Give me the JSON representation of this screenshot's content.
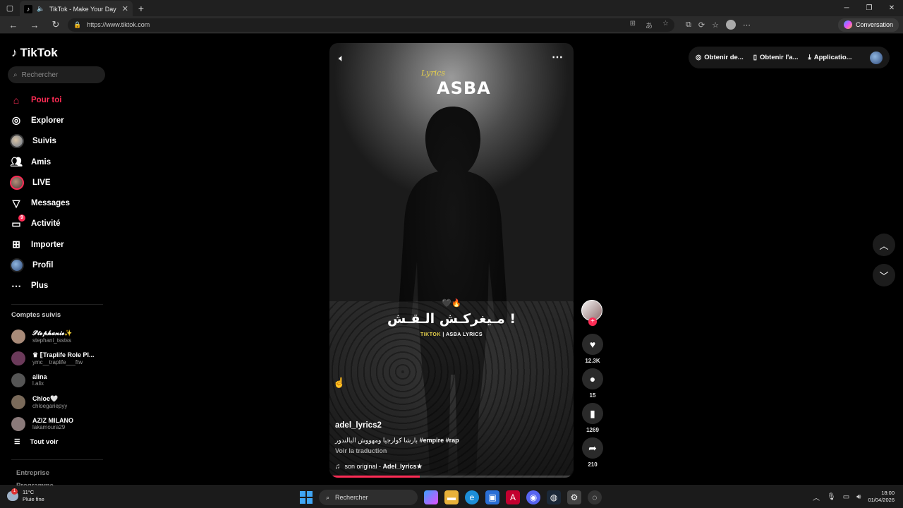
{
  "browser": {
    "tab_title": "TikTok - Make Your Day",
    "url": "https://www.tiktok.com",
    "conversation_label": "Conversation"
  },
  "sidebar": {
    "brand": "TikTok",
    "search_placeholder": "Rechercher",
    "menu": [
      {
        "label": "Pour toi",
        "icon": "home-icon",
        "active": true
      },
      {
        "label": "Explorer",
        "icon": "compass-icon"
      },
      {
        "label": "Suivis",
        "icon": "avatar"
      },
      {
        "label": "Amis",
        "icon": "friends-icon"
      },
      {
        "label": "LIVE",
        "icon": "live-avatar"
      },
      {
        "label": "Messages",
        "icon": "send-icon"
      },
      {
        "label": "Activité",
        "icon": "inbox-icon",
        "badge": "9"
      },
      {
        "label": "Importer",
        "icon": "plus-square-icon"
      },
      {
        "label": "Profil",
        "icon": "profile-avatar"
      },
      {
        "label": "Plus",
        "icon": "more-icon"
      }
    ],
    "following_title": "Comptes suivis",
    "following": [
      {
        "name": "𝓢𝓽𝓮𝓹𝓱𝓪𝓷𝓲𝓮✨",
        "handle": "stephani_tsstss",
        "color": "#a88a78"
      },
      {
        "name": "♛ ⟦Traplife Role Pl...",
        "handle": "ymc__traplife___ftw",
        "color": "#6b3a5a"
      },
      {
        "name": "alina",
        "handle": "l.alix",
        "color": "#555555"
      },
      {
        "name": "Chloe🤍",
        "handle": "chloegariepyy",
        "color": "#7a6a5a"
      },
      {
        "name": "AZIZ MILANO",
        "handle": "lakamoura29",
        "color": "#8a7a7a"
      }
    ],
    "see_all": "Tout voir",
    "footer_1": "Entreprise",
    "footer_2": "Programme"
  },
  "video": {
    "logo_script": "Lyrics",
    "logo_main": "ASBA",
    "emoji_line": "🖤🔥",
    "overlay_title": "مـيغركـش الـقـش !",
    "overlay_sub_1": "TIKTOK",
    "overlay_sub_sep": " | ",
    "overlay_sub_2": "ASBA LYRICS",
    "author": "adel_lyrics2",
    "description_text": "بارشا كوارجيا ومهووش البالندور",
    "description_tags": "#empire #rap",
    "translate": "Voir la traduction",
    "music_prefix": "son original - ",
    "music_author": "Adel_lyrics★",
    "progress": 0.37
  },
  "actions": {
    "likes": "12.3K",
    "comments": "15",
    "saves": "1269",
    "shares": "210"
  },
  "topright": {
    "item1": "Obtenir de...",
    "item2": "Obtenir l'a...",
    "item3": "Applicatio..."
  },
  "taskbar": {
    "temperature": "11°C",
    "weather": "Pluie fine",
    "weather_alert": "1",
    "search": "Rechercher",
    "time": "18:00",
    "date": "01/04/2026"
  },
  "colors": {
    "accent": "#fe2c55",
    "background": "#000000"
  }
}
